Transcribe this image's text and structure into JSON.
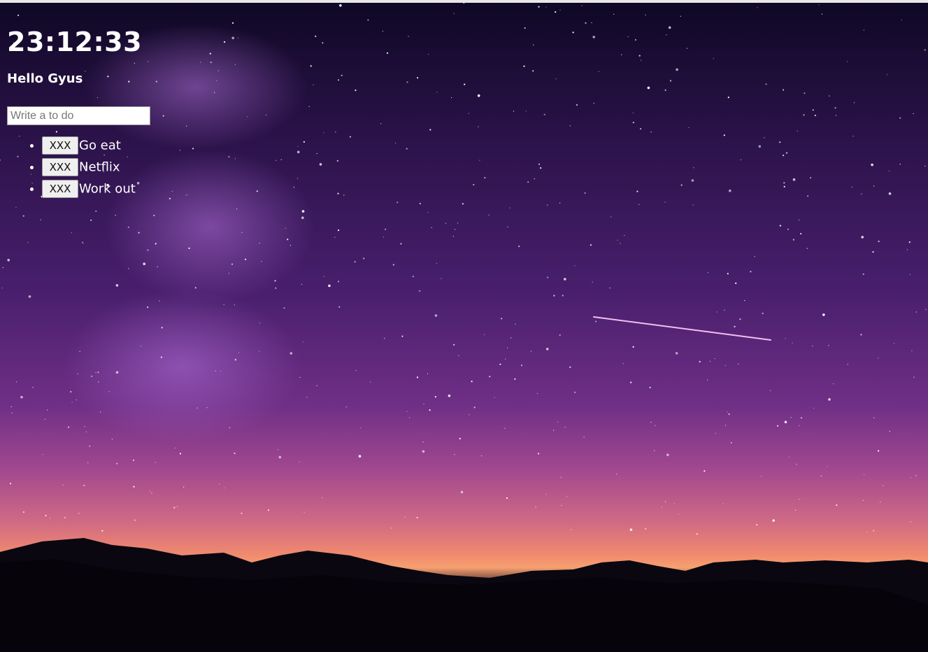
{
  "clock": {
    "time": "23:12:33"
  },
  "greeting": {
    "text": "Hello Gyus"
  },
  "todo_form": {
    "placeholder": "Write a to do",
    "value": ""
  },
  "todos": [
    {
      "delete_label": "XXX",
      "text": "Go eat"
    },
    {
      "delete_label": "XXX",
      "text": "Netflix"
    },
    {
      "delete_label": "XXX",
      "text": "Work out"
    }
  ],
  "background": {
    "description_icon": "starry-night-sky-image",
    "colors": {
      "sky_top": "#0f0825",
      "sky_mid": "#4a1f6e",
      "horizon_glow": "#f08a6e",
      "mountains": "#0a0710"
    }
  }
}
